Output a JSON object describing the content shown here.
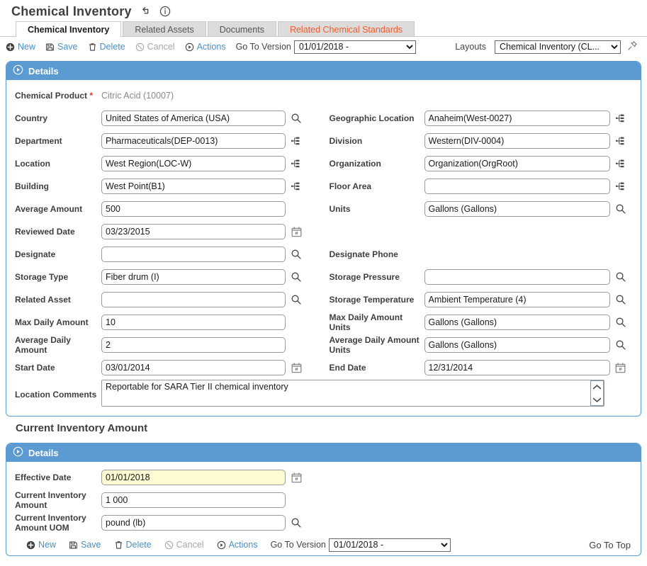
{
  "header": {
    "title": "Chemical Inventory",
    "icons": [
      "undo-icon",
      "info-icon"
    ]
  },
  "tabs": [
    {
      "label": "Chemical Inventory",
      "state": "active"
    },
    {
      "label": "Related Assets",
      "state": "inactive"
    },
    {
      "label": "Documents",
      "state": "inactive"
    },
    {
      "label": "Related Chemical Standards",
      "state": "alert"
    }
  ],
  "toolbar": {
    "new_label": "New",
    "save_label": "Save",
    "delete_label": "Delete",
    "cancel_label": "Cancel",
    "actions_label": "Actions",
    "goto_version_label": "Go To Version",
    "version_value": "01/01/2018 -",
    "layouts_label": "Layouts",
    "layout_value": "Chemical Inventory (CL..."
  },
  "panel1": {
    "header": "Details",
    "chemical_product_label": "Chemical Product",
    "chemical_product_value": "Citric Acid (10007)",
    "rows": [
      {
        "left": {
          "label": "Country",
          "value": "United States of America (USA)",
          "adorn": "search-icon"
        },
        "right": {
          "label": "Geographic Location",
          "value": "Anaheim(West-0027)",
          "adorn": "tree-icon"
        }
      },
      {
        "left": {
          "label": "Department",
          "value": "Pharmaceuticals(DEP-0013)",
          "adorn": "tree-icon"
        },
        "right": {
          "label": "Division",
          "value": "Western(DIV-0004)",
          "adorn": "tree-icon"
        }
      },
      {
        "left": {
          "label": "Location",
          "value": "West Region(LOC-W)",
          "adorn": "tree-icon"
        },
        "right": {
          "label": "Organization",
          "value": "Organization(OrgRoot)",
          "adorn": "tree-icon"
        }
      },
      {
        "left": {
          "label": "Building",
          "value": "West Point(B1)",
          "adorn": "tree-icon"
        },
        "right": {
          "label": "Floor Area",
          "value": "",
          "adorn": "tree-icon"
        }
      },
      {
        "left": {
          "label": "Average Amount",
          "value": "500",
          "adorn": "none"
        },
        "right": {
          "label": "Units",
          "value": "Gallons (Gallons)",
          "adorn": "search-icon"
        }
      },
      {
        "left": {
          "label": "Reviewed Date",
          "value": "03/23/2015",
          "adorn": "calendar-icon"
        },
        "right": {
          "label": "",
          "value": null,
          "adorn": "none"
        }
      },
      {
        "left": {
          "label": "Designate",
          "value": "",
          "adorn": "search-icon"
        },
        "right": {
          "label": "Designate Phone",
          "value": null,
          "adorn": "none"
        }
      },
      {
        "left": {
          "label": "Storage Type",
          "value": "Fiber drum (I)",
          "adorn": "search-icon"
        },
        "right": {
          "label": "Storage Pressure",
          "value": "",
          "adorn": "search-icon"
        }
      },
      {
        "left": {
          "label": "Related Asset",
          "value": "",
          "adorn": "search-icon"
        },
        "right": {
          "label": "Storage Temperature",
          "value": "Ambient Temperature (4)",
          "adorn": "search-icon"
        }
      },
      {
        "left": {
          "label": "Max Daily Amount",
          "value": "10",
          "adorn": "none"
        },
        "right": {
          "label": "Max Daily Amount Units",
          "value": "Gallons (Gallons)",
          "adorn": "search-icon"
        }
      },
      {
        "left": {
          "label": "Average Daily Amount",
          "value": "2",
          "adorn": "none"
        },
        "right": {
          "label": "Average Daily Amount Units",
          "value": "Gallons (Gallons)",
          "adorn": "search-icon"
        }
      },
      {
        "left": {
          "label": "Start Date",
          "value": "03/01/2014",
          "adorn": "calendar-icon"
        },
        "right": {
          "label": "End Date",
          "value": "12/31/2014",
          "adorn": "calendar-icon"
        }
      }
    ],
    "comments_label": "Location Comments",
    "comments_value": "Reportable for SARA Tier II chemical inventory"
  },
  "section2_title": "Current Inventory Amount",
  "panel2": {
    "header": "Details",
    "rows": [
      {
        "label": "Effective Date",
        "value": "01/01/2018",
        "adorn": "calendar-icon",
        "highlight": true
      },
      {
        "label": "Current Inventory Amount",
        "value": "1 000",
        "adorn": "none",
        "highlight": false
      },
      {
        "label": "Current Inventory Amount UOM",
        "value": "pound (lb)",
        "adorn": "search-icon",
        "highlight": false
      }
    ]
  },
  "bottom": {
    "new_label": "New",
    "save_label": "Save",
    "delete_label": "Delete",
    "cancel_label": "Cancel",
    "actions_label": "Actions",
    "goto_version_label": "Go To Version",
    "version_value": "01/01/2018 -",
    "goto_top_label": "Go To Top"
  },
  "colors": {
    "panel_blue": "#5b9bd1",
    "link_blue": "#4a90c4",
    "alert_orange": "#f15a29",
    "required_red": "#e8352a",
    "highlight_yellow": "#fdfbd2"
  }
}
